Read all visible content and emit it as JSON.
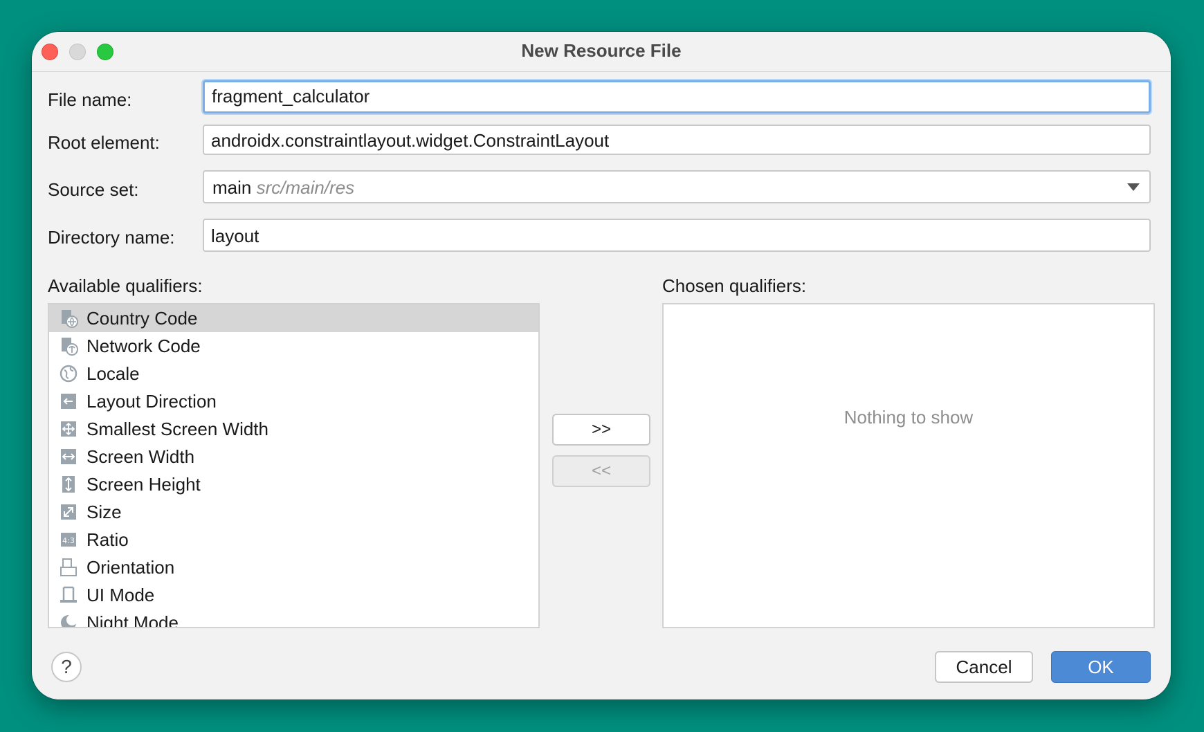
{
  "window": {
    "title": "New Resource File"
  },
  "form": {
    "file_name": {
      "label": "File name:",
      "value": "fragment_calculator"
    },
    "root_element": {
      "label": "Root element:",
      "value": "androidx.constraintlayout.widget.ConstraintLayout"
    },
    "source_set": {
      "label": "Source set:",
      "value": "main",
      "hint": "src/main/res"
    },
    "directory_name": {
      "label": "Directory name:",
      "value": "layout"
    }
  },
  "qualifiers": {
    "available_label": "Available qualifiers:",
    "chosen_label": "Chosen qualifiers:",
    "available": [
      {
        "label": "Country Code",
        "icon": "country-code-icon",
        "selected": true
      },
      {
        "label": "Network Code",
        "icon": "network-code-icon"
      },
      {
        "label": "Locale",
        "icon": "globe-icon"
      },
      {
        "label": "Layout Direction",
        "icon": "arrow-left-icon"
      },
      {
        "label": "Smallest Screen Width",
        "icon": "expand-arrows-icon"
      },
      {
        "label": "Screen Width",
        "icon": "horizontal-arrows-icon"
      },
      {
        "label": "Screen Height",
        "icon": "vertical-arrows-icon"
      },
      {
        "label": "Size",
        "icon": "diagonal-resize-icon"
      },
      {
        "label": "Ratio",
        "icon": "ratio-icon"
      },
      {
        "label": "Orientation",
        "icon": "orientation-icon"
      },
      {
        "label": "UI Mode",
        "icon": "ui-mode-icon"
      },
      {
        "label": "Night Mode",
        "icon": "moon-icon"
      }
    ],
    "chosen_empty_text": "Nothing to show",
    "add_label": ">>",
    "remove_label": "<<"
  },
  "buttons": {
    "help": "?",
    "cancel": "Cancel",
    "ok": "OK"
  },
  "colors": {
    "background": "#00907f",
    "primary": "#4d8ad6",
    "focus_ring": "#7aaee6"
  }
}
